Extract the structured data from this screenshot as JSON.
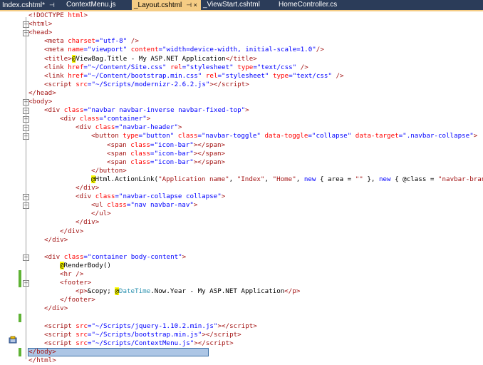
{
  "tabs": [
    {
      "label": "Index.cshtml*",
      "pin": "⊣",
      "active": false
    },
    {
      "label": "ContextMenu.js",
      "pin": "",
      "active": false
    },
    {
      "label": "_Layout.cshtml",
      "pin": "⊣ ×",
      "active": true
    },
    {
      "label": "_ViewStart.cshtml",
      "pin": "",
      "active": false
    },
    {
      "label": "HomeController.cs",
      "pin": "",
      "active": false
    }
  ],
  "lines": [
    {
      "indent": 0,
      "tokens": [
        [
          "t",
          "<!DOCTYPE "
        ],
        [
          "a",
          "html"
        ],
        [
          "t",
          ">"
        ]
      ]
    },
    {
      "indent": 0,
      "tokens": [
        [
          "t",
          "<"
        ],
        [
          "t",
          "html"
        ],
        [
          "t",
          ">"
        ]
      ]
    },
    {
      "indent": 0,
      "tokens": [
        [
          "t",
          "<"
        ],
        [
          "t",
          "head"
        ],
        [
          "t",
          ">"
        ]
      ]
    },
    {
      "indent": 1,
      "tokens": [
        [
          "t",
          "<"
        ],
        [
          "t",
          "meta"
        ],
        [
          "p",
          " "
        ],
        [
          "a",
          "charset"
        ],
        [
          "v",
          "=\"utf-8\""
        ],
        [
          "p",
          " "
        ],
        [
          "t",
          "/>"
        ]
      ]
    },
    {
      "indent": 1,
      "tokens": [
        [
          "t",
          "<"
        ],
        [
          "t",
          "meta"
        ],
        [
          "p",
          " "
        ],
        [
          "a",
          "name"
        ],
        [
          "v",
          "=\"viewport\""
        ],
        [
          "p",
          " "
        ],
        [
          "a",
          "content"
        ],
        [
          "v",
          "=\"width=device-width, initial-scale=1.0\""
        ],
        [
          "t",
          "/>"
        ]
      ]
    },
    {
      "indent": 1,
      "tokens": [
        [
          "t",
          "<"
        ],
        [
          "t",
          "title"
        ],
        [
          "t",
          ">"
        ],
        [
          "raz",
          "@"
        ],
        [
          "p",
          "ViewBag.Title - My ASP.NET Application"
        ],
        [
          "t",
          "</"
        ],
        [
          "t",
          "title"
        ],
        [
          "t",
          ">"
        ]
      ]
    },
    {
      "indent": 1,
      "tokens": [
        [
          "t",
          "<"
        ],
        [
          "t",
          "link"
        ],
        [
          "p",
          " "
        ],
        [
          "a",
          "href"
        ],
        [
          "v",
          "=\"~/Content/Site.css\""
        ],
        [
          "p",
          " "
        ],
        [
          "a",
          "rel"
        ],
        [
          "v",
          "=\"stylesheet\""
        ],
        [
          "p",
          " "
        ],
        [
          "a",
          "type"
        ],
        [
          "v",
          "=\"text/css\""
        ],
        [
          "p",
          " "
        ],
        [
          "t",
          "/>"
        ]
      ]
    },
    {
      "indent": 1,
      "tokens": [
        [
          "t",
          "<"
        ],
        [
          "t",
          "link"
        ],
        [
          "p",
          " "
        ],
        [
          "a",
          "href"
        ],
        [
          "v",
          "=\"~/Content/bootstrap.min.css\""
        ],
        [
          "p",
          " "
        ],
        [
          "a",
          "rel"
        ],
        [
          "v",
          "=\"stylesheet\""
        ],
        [
          "p",
          " "
        ],
        [
          "a",
          "type"
        ],
        [
          "v",
          "=\"text/css\""
        ],
        [
          "p",
          " "
        ],
        [
          "t",
          "/>"
        ]
      ]
    },
    {
      "indent": 1,
      "tokens": [
        [
          "t",
          "<"
        ],
        [
          "t",
          "script"
        ],
        [
          "p",
          " "
        ],
        [
          "a",
          "src"
        ],
        [
          "v",
          "=\"~/Scripts/modernizr-2.6.2.js\""
        ],
        [
          "t",
          "></"
        ],
        [
          "t",
          "script"
        ],
        [
          "t",
          ">"
        ]
      ]
    },
    {
      "indent": 0,
      "tokens": [
        [
          "t",
          "</"
        ],
        [
          "t",
          "head"
        ],
        [
          "t",
          ">"
        ]
      ]
    },
    {
      "indent": 0,
      "tokens": [
        [
          "t",
          "<"
        ],
        [
          "t",
          "body"
        ],
        [
          "t",
          ">"
        ]
      ]
    },
    {
      "indent": 1,
      "tokens": [
        [
          "t",
          "<"
        ],
        [
          "t",
          "div"
        ],
        [
          "p",
          " "
        ],
        [
          "a",
          "class"
        ],
        [
          "v",
          "=\"navbar navbar-inverse navbar-fixed-top\""
        ],
        [
          "t",
          ">"
        ]
      ]
    },
    {
      "indent": 2,
      "tokens": [
        [
          "t",
          "<"
        ],
        [
          "t",
          "div"
        ],
        [
          "p",
          " "
        ],
        [
          "a",
          "class"
        ],
        [
          "v",
          "=\"container\""
        ],
        [
          "t",
          ">"
        ]
      ]
    },
    {
      "indent": 3,
      "tokens": [
        [
          "t",
          "<"
        ],
        [
          "t",
          "div"
        ],
        [
          "p",
          " "
        ],
        [
          "a",
          "class"
        ],
        [
          "v",
          "=\"navbar-header\""
        ],
        [
          "t",
          ">"
        ]
      ]
    },
    {
      "indent": 4,
      "tokens": [
        [
          "t",
          "<"
        ],
        [
          "t",
          "button"
        ],
        [
          "p",
          " "
        ],
        [
          "a",
          "type"
        ],
        [
          "v",
          "=\"button\""
        ],
        [
          "p",
          " "
        ],
        [
          "a",
          "class"
        ],
        [
          "v",
          "=\"navbar-toggle\""
        ],
        [
          "p",
          " "
        ],
        [
          "a",
          "data-toggle"
        ],
        [
          "v",
          "=\"collapse\""
        ],
        [
          "p",
          " "
        ],
        [
          "a",
          "data-target"
        ],
        [
          "v",
          "=\".navbar-collapse\""
        ],
        [
          "t",
          ">"
        ]
      ]
    },
    {
      "indent": 5,
      "tokens": [
        [
          "t",
          "<"
        ],
        [
          "t",
          "span"
        ],
        [
          "p",
          " "
        ],
        [
          "a",
          "class"
        ],
        [
          "v",
          "=\"icon-bar\""
        ],
        [
          "t",
          "></"
        ],
        [
          "t",
          "span"
        ],
        [
          "t",
          ">"
        ]
      ]
    },
    {
      "indent": 5,
      "tokens": [
        [
          "t",
          "<"
        ],
        [
          "t",
          "span"
        ],
        [
          "p",
          " "
        ],
        [
          "a",
          "class"
        ],
        [
          "v",
          "=\"icon-bar\""
        ],
        [
          "t",
          "></"
        ],
        [
          "t",
          "span"
        ],
        [
          "t",
          ">"
        ]
      ]
    },
    {
      "indent": 5,
      "tokens": [
        [
          "t",
          "<"
        ],
        [
          "t",
          "span"
        ],
        [
          "p",
          " "
        ],
        [
          "a",
          "class"
        ],
        [
          "v",
          "=\"icon-bar\""
        ],
        [
          "t",
          "></"
        ],
        [
          "t",
          "span"
        ],
        [
          "t",
          ">"
        ]
      ]
    },
    {
      "indent": 4,
      "tokens": [
        [
          "t",
          "</"
        ],
        [
          "t",
          "button"
        ],
        [
          "t",
          ">"
        ]
      ]
    },
    {
      "indent": 4,
      "tokens": [
        [
          "raz",
          "@"
        ],
        [
          "p",
          "Html.ActionLink("
        ],
        [
          "s",
          "\"Application name\""
        ],
        [
          "p",
          ", "
        ],
        [
          "s",
          "\"Index\""
        ],
        [
          "p",
          ", "
        ],
        [
          "s",
          "\"Home\""
        ],
        [
          "p",
          ", "
        ],
        [
          "k",
          "new"
        ],
        [
          "p",
          " { area = "
        ],
        [
          "s",
          "\"\""
        ],
        [
          "p",
          " }, "
        ],
        [
          "k",
          "new"
        ],
        [
          "p",
          " { @class = "
        ],
        [
          "s",
          "\"navbar-brand\""
        ],
        [
          "p",
          " })"
        ]
      ]
    },
    {
      "indent": 3,
      "tokens": [
        [
          "t",
          "</"
        ],
        [
          "t",
          "div"
        ],
        [
          "t",
          ">"
        ]
      ]
    },
    {
      "indent": 3,
      "tokens": [
        [
          "t",
          "<"
        ],
        [
          "t",
          "div"
        ],
        [
          "p",
          " "
        ],
        [
          "a",
          "class"
        ],
        [
          "v",
          "=\"navbar-collapse collapse\""
        ],
        [
          "t",
          ">"
        ]
      ]
    },
    {
      "indent": 4,
      "tokens": [
        [
          "t",
          "<"
        ],
        [
          "t",
          "ul"
        ],
        [
          "p",
          " "
        ],
        [
          "a",
          "class"
        ],
        [
          "v",
          "=\"nav navbar-nav\""
        ],
        [
          "t",
          ">"
        ]
      ]
    },
    {
      "indent": 4,
      "tokens": [
        [
          "t",
          "</"
        ],
        [
          "t",
          "ul"
        ],
        [
          "t",
          ">"
        ]
      ]
    },
    {
      "indent": 3,
      "tokens": [
        [
          "t",
          "</"
        ],
        [
          "t",
          "div"
        ],
        [
          "t",
          ">"
        ]
      ]
    },
    {
      "indent": 2,
      "tokens": [
        [
          "t",
          "</"
        ],
        [
          "t",
          "div"
        ],
        [
          "t",
          ">"
        ]
      ]
    },
    {
      "indent": 1,
      "tokens": [
        [
          "t",
          "</"
        ],
        [
          "t",
          "div"
        ],
        [
          "t",
          ">"
        ]
      ]
    },
    {
      "indent": 0,
      "tokens": []
    },
    {
      "indent": 1,
      "tokens": [
        [
          "t",
          "<"
        ],
        [
          "t",
          "div"
        ],
        [
          "p",
          " "
        ],
        [
          "a",
          "class"
        ],
        [
          "v",
          "=\"container body-content\""
        ],
        [
          "t",
          ">"
        ]
      ]
    },
    {
      "indent": 2,
      "tokens": [
        [
          "raz",
          "@"
        ],
        [
          "p",
          "RenderBody()"
        ]
      ]
    },
    {
      "indent": 2,
      "tokens": [
        [
          "t",
          "<"
        ],
        [
          "t",
          "hr"
        ],
        [
          "p",
          " "
        ],
        [
          "t",
          "/>"
        ]
      ]
    },
    {
      "indent": 2,
      "tokens": [
        [
          "t",
          "<"
        ],
        [
          "t",
          "footer"
        ],
        [
          "t",
          ">"
        ]
      ]
    },
    {
      "indent": 3,
      "tokens": [
        [
          "t",
          "<"
        ],
        [
          "t",
          "p"
        ],
        [
          "t",
          ">"
        ],
        [
          "p",
          "&copy; "
        ],
        [
          "raz",
          "@"
        ],
        [
          "c",
          "DateTime"
        ],
        [
          "p",
          ".Now.Year - My ASP.NET Application"
        ],
        [
          "t",
          "</"
        ],
        [
          "t",
          "p"
        ],
        [
          "t",
          ">"
        ]
      ]
    },
    {
      "indent": 2,
      "tokens": [
        [
          "t",
          "</"
        ],
        [
          "t",
          "footer"
        ],
        [
          "t",
          ">"
        ]
      ]
    },
    {
      "indent": 1,
      "tokens": [
        [
          "t",
          "</"
        ],
        [
          "t",
          "div"
        ],
        [
          "t",
          ">"
        ]
      ]
    },
    {
      "indent": 0,
      "tokens": []
    },
    {
      "indent": 1,
      "tokens": [
        [
          "t",
          "<"
        ],
        [
          "t",
          "script"
        ],
        [
          "p",
          " "
        ],
        [
          "a",
          "src"
        ],
        [
          "v",
          "=\"~/Scripts/jquery-1.10.2.min.js\""
        ],
        [
          "t",
          "></"
        ],
        [
          "t",
          "script"
        ],
        [
          "t",
          ">"
        ]
      ]
    },
    {
      "indent": 1,
      "tokens": [
        [
          "t",
          "<"
        ],
        [
          "t",
          "script"
        ],
        [
          "p",
          " "
        ],
        [
          "a",
          "src"
        ],
        [
          "v",
          "=\"~/Scripts/bootstrap.min.js\""
        ],
        [
          "t",
          "></"
        ],
        [
          "t",
          "script"
        ],
        [
          "t",
          ">"
        ]
      ]
    },
    {
      "indent": 1,
      "tokens": [
        [
          "t",
          "<"
        ],
        [
          "t",
          "script"
        ],
        [
          "p",
          " "
        ],
        [
          "a",
          "src"
        ],
        [
          "v",
          "=\"~/Scripts/ContextMenu.js\""
        ],
        [
          "t",
          "></"
        ],
        [
          "t",
          "script"
        ],
        [
          "t",
          ">"
        ]
      ]
    },
    {
      "indent": 0,
      "tokens": [
        [
          "t",
          "</"
        ],
        [
          "t",
          "body"
        ],
        [
          "t",
          ">"
        ]
      ]
    },
    {
      "indent": 0,
      "tokens": [
        [
          "t",
          "</"
        ],
        [
          "t",
          "html"
        ],
        [
          "t",
          ">"
        ]
      ]
    }
  ],
  "selected_line": 39,
  "change_markers": [
    [
      30,
      31
    ],
    [
      35,
      35
    ],
    [
      39,
      39
    ]
  ],
  "fold_starts": [
    1,
    2,
    10,
    11,
    12,
    13,
    14,
    21,
    22,
    28,
    31
  ],
  "colors": {
    "tag": "#a31515",
    "attr": "#ff0000",
    "value": "#0000ff",
    "razor_bg": "#ffff00",
    "type": "#2b91af",
    "tab_bg": "#2b3c59",
    "tab_active": "#f5cc84",
    "selection": "#adc6e5"
  },
  "icons": {
    "pin": "pin-icon",
    "close": "close-icon",
    "smart_tag": "smart-tag-icon"
  }
}
